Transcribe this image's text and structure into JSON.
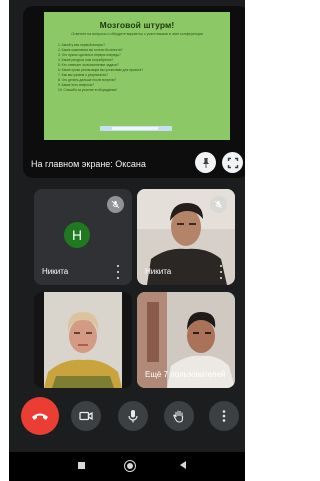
{
  "presentation": {
    "slide": {
      "title": "Мозговой штурм!",
      "subtitle": "Ответьте на вопросы и обсудите варианты с участниками в чате конференции",
      "items": [
        "1. Какой у вас первый вопрос?",
        "2. Какие изменения вы хотели бы внести?",
        "3. Что нужно сделать в первую очередь?",
        "4. Какие ресурсы нам потребуются?",
        "5. Кто отвечает за выполнение задачи?",
        "6. Какие сроки реализации мы установим для проекта?",
        "7. Как мы узнаем о результатах?",
        "8. Что делать дальше после встречи?",
        "9. Какие есть вопросы?",
        "10. Спасибо за участие в обсуждении!"
      ]
    },
    "caption": "На главном экране: Оксана",
    "pin_icon": "pin-icon",
    "fullscreen_icon": "fullscreen-icon"
  },
  "participants": [
    {
      "name": "Никита",
      "avatar_letter": "Н",
      "avatar_color": "#1f7a1f"
    },
    {
      "name": "Никита"
    },
    {
      "name": ""
    },
    {
      "name": "Ещё 7 пользователей"
    }
  ],
  "controls": [
    {
      "icon": "hang-up-icon",
      "color": "#ea3d33"
    },
    {
      "icon": "camera-icon"
    },
    {
      "icon": "microphone-icon"
    },
    {
      "icon": "raise-hand-icon"
    },
    {
      "icon": "more-options-icon"
    }
  ],
  "navigation": [
    "recent-apps-icon",
    "home-icon",
    "back-icon"
  ]
}
